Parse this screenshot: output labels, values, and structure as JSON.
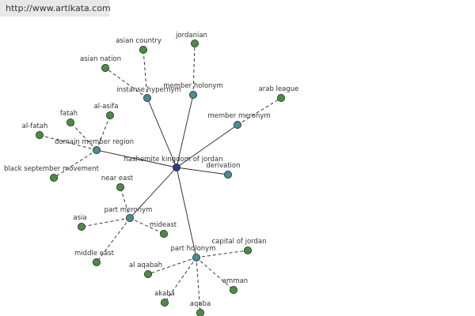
{
  "site_url": "http://www.artikata.com",
  "colors": {
    "center": "#2e3a8c",
    "relation": "#4a8c94",
    "leaf": "#4e8a46",
    "edge": "#222222",
    "label": "#333333",
    "url_bg": "#e8e8e8"
  },
  "graph": {
    "center": {
      "id": "center",
      "label": "hashemite kingdom of jordan"
    },
    "relations": [
      {
        "id": "instance-hypernym",
        "label": "instanse hypernym",
        "leaves": [
          {
            "id": "asian-country",
            "label": "asian country"
          },
          {
            "id": "asian-nation",
            "label": "asian nation"
          }
        ]
      },
      {
        "id": "member-holonym",
        "label": "member holonym",
        "leaves": [
          {
            "id": "jordanian",
            "label": "jordanian"
          }
        ]
      },
      {
        "id": "member-meronym",
        "label": "member meronym",
        "leaves": [
          {
            "id": "arab-league",
            "label": "arab league"
          }
        ]
      },
      {
        "id": "domain-member-region",
        "label": "domain member region",
        "leaves": [
          {
            "id": "al-asifa",
            "label": "al-asifa"
          },
          {
            "id": "fatah",
            "label": "fatah"
          },
          {
            "id": "al-fatah",
            "label": "al-fatah"
          },
          {
            "id": "black-september-movement",
            "label": "black september movement"
          }
        ]
      },
      {
        "id": "derivation",
        "label": "derivation",
        "leaves": []
      },
      {
        "id": "part-meronym",
        "label": "part meronym",
        "leaves": [
          {
            "id": "near-east",
            "label": "near east"
          },
          {
            "id": "asia",
            "label": "asia"
          },
          {
            "id": "mideast",
            "label": "mideast"
          },
          {
            "id": "middle-east",
            "label": "middle east"
          }
        ]
      },
      {
        "id": "part-holonym",
        "label": "part holonym",
        "leaves": [
          {
            "id": "capital-of-jordan",
            "label": "capital of jordan"
          },
          {
            "id": "al-aqabah",
            "label": "al aqabah"
          },
          {
            "id": "amman",
            "label": "amman"
          },
          {
            "id": "akaba",
            "label": "akaba"
          },
          {
            "id": "aqaba",
            "label": "aqaba"
          }
        ]
      }
    ]
  }
}
